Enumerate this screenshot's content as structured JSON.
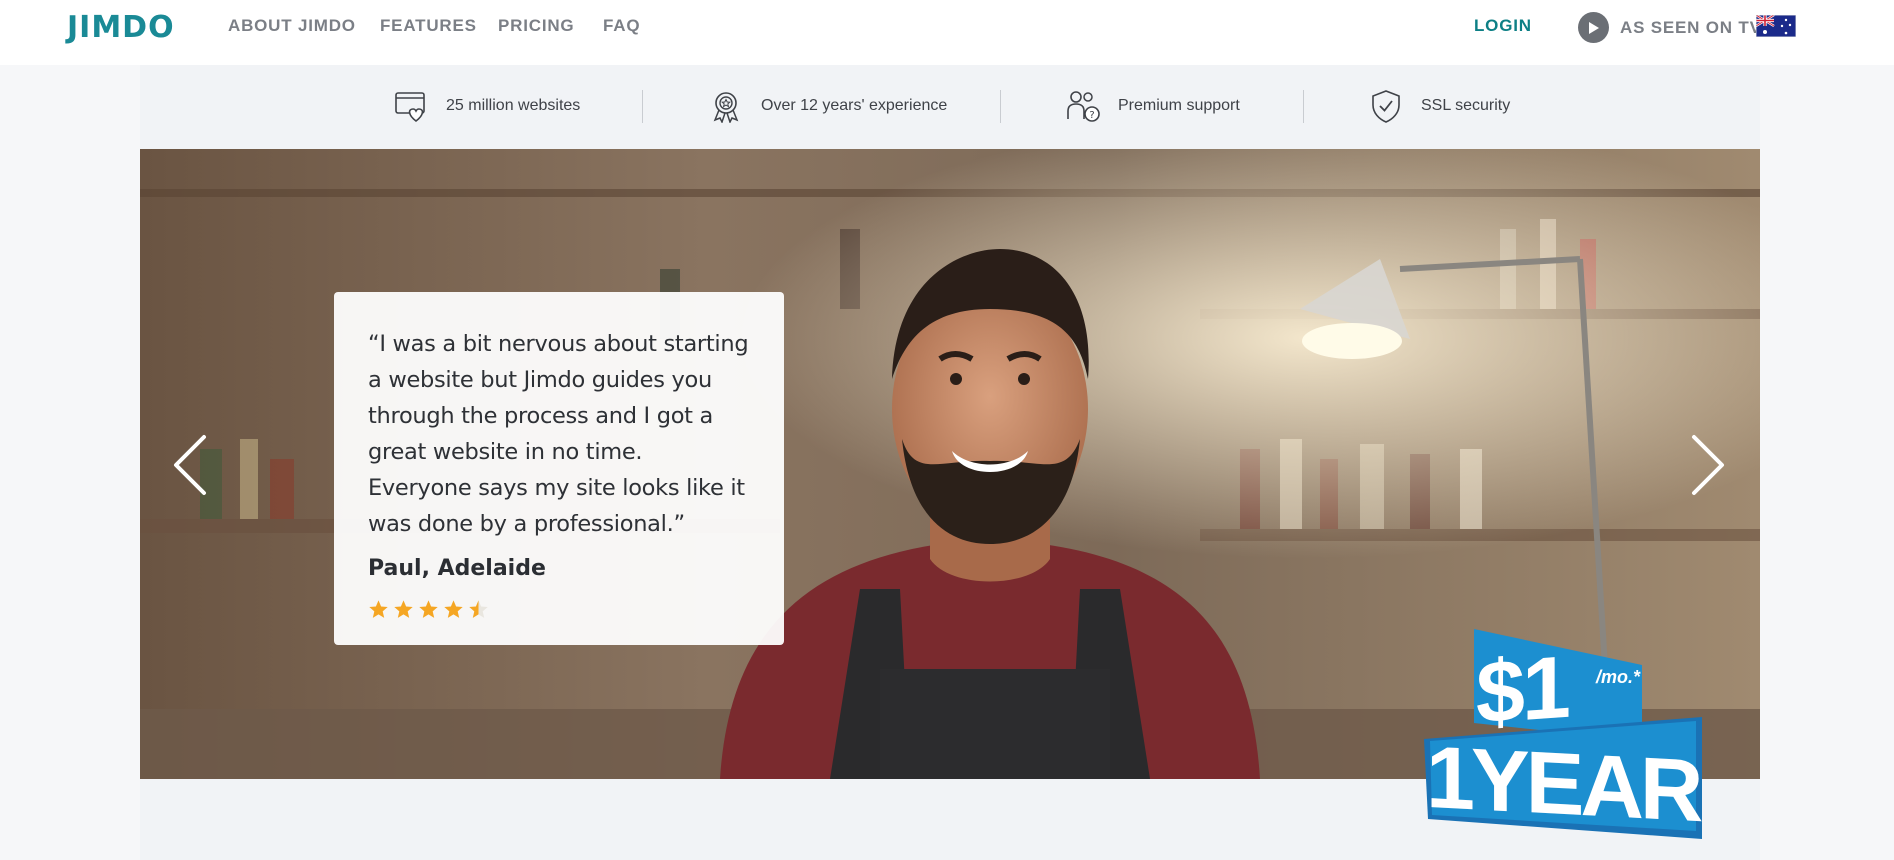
{
  "header": {
    "logo": "JIMDO",
    "nav": [
      "ABOUT JIMDO",
      "FEATURES",
      "PRICING",
      "FAQ"
    ],
    "login": "LOGIN",
    "tv_label": "AS SEEN ON TV",
    "flag": "australia-flag"
  },
  "trust": [
    {
      "icon": "website-heart-icon",
      "label": "25 million websites"
    },
    {
      "icon": "award-icon",
      "label": "Over 12 years' experience"
    },
    {
      "icon": "support-people-icon",
      "label": "Premium support"
    },
    {
      "icon": "shield-check-icon",
      "label": "SSL security"
    }
  ],
  "testimonial": {
    "quote": "“I was a bit nervous about starting a website but Jimdo guides you through the process and I got a great website in no time. Everyone says my site looks like it was done by a professional.”",
    "author": "Paul, Adelaide",
    "rating": 4.5,
    "rating_max": 5
  },
  "promo": {
    "price": "$1",
    "per": "/mo.*",
    "term": "1YEAR"
  },
  "colors": {
    "brand": "#1a8a96",
    "login": "#0d7f85",
    "star": "#f5a623",
    "promo": "#1c8fd0"
  }
}
